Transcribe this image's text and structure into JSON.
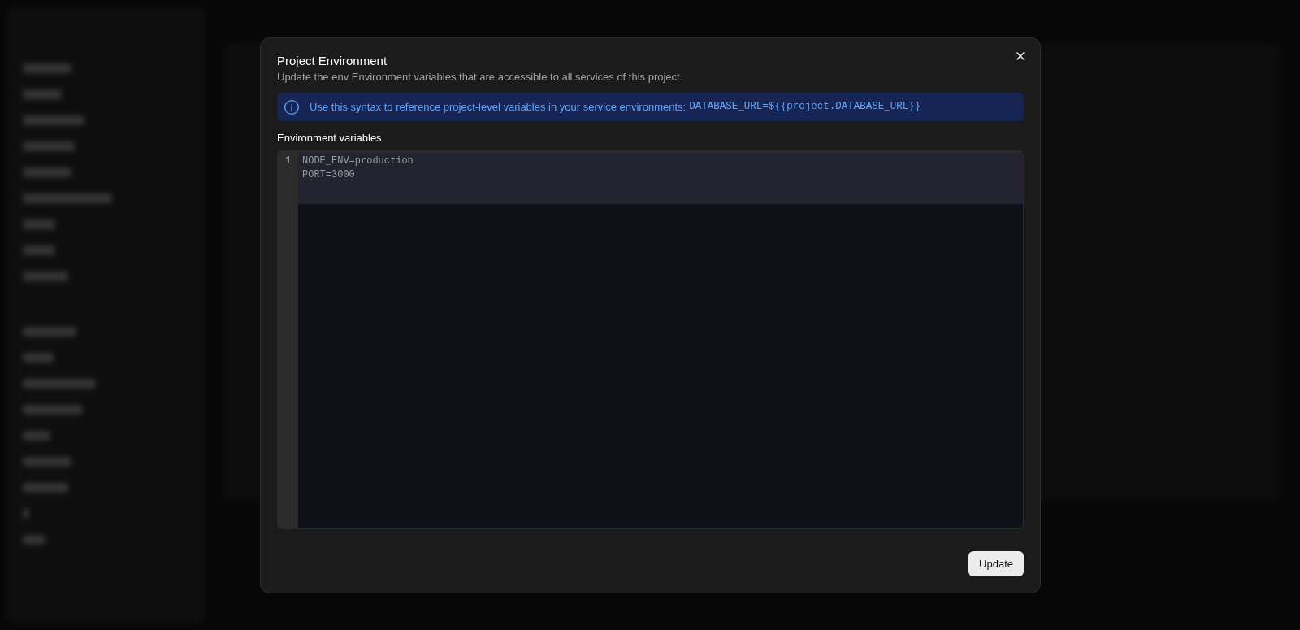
{
  "dialog": {
    "title": "Project Environment",
    "description": "Update the env Environment variables that are accessible to all services of this project.",
    "notice": {
      "text": "Use this syntax to reference project-level variables in your service environments:",
      "code": "DATABASE_URL=${{project.DATABASE_URL}}"
    },
    "editor": {
      "label": "Environment variables",
      "line_numbers": [
        "1"
      ],
      "lines": [
        "NODE_ENV=production",
        "PORT=3000"
      ]
    },
    "buttons": [
      "Update"
    ]
  }
}
